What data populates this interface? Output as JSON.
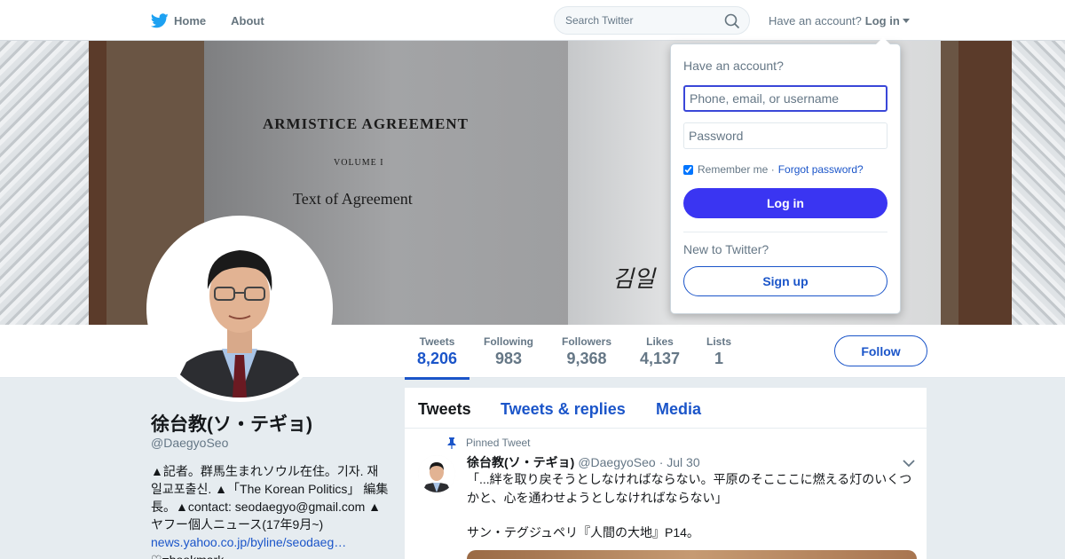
{
  "nav": {
    "home_label": "Home",
    "about_label": "About",
    "search_placeholder": "Search Twitter",
    "account_prompt": "Have an account?",
    "login_label": "Log in"
  },
  "banner": {
    "doc_title": "ARMISTICE AGREEMENT",
    "doc_volume": "VOLUME I",
    "doc_subtitle": "Text of Agreement"
  },
  "stats": [
    {
      "label": "Tweets",
      "value": "8,206"
    },
    {
      "label": "Following",
      "value": "983"
    },
    {
      "label": "Followers",
      "value": "9,368"
    },
    {
      "label": "Likes",
      "value": "4,137"
    },
    {
      "label": "Lists",
      "value": "1"
    }
  ],
  "follow_label": "Follow",
  "profile": {
    "name": "徐台教(ソ・テギョ)",
    "handle": "@DaegyoSeo",
    "bio_lines": [
      "▲記者。群馬生まれソウル在住。기자. 재일교포출신. ▲「The Korean Politics」 編集長。▲contact: seodaegyo@gmail.com ▲ヤフー個人ニュース(17年9月~)"
    ],
    "bio_link": "news.yahoo.co.jp/byline/seodaeg…",
    "bio_tail": "♡=bookmark"
  },
  "timeline": {
    "tabs": [
      "Tweets",
      "Tweets & replies",
      "Media"
    ],
    "pinned_label": "Pinned Tweet",
    "tweet_name": "徐台教(ソ・テギョ)",
    "tweet_handle": "@DaegyoSeo",
    "tweet_date": "· Jul 30",
    "tweet_text": "「...絆を取り戻そうとしなければならない。平原のそこここに燃える灯のいくつかと、心を通わせようとしなければならない」",
    "tweet_line2": "サン・テグジュペリ『人間の大地』P14。"
  },
  "login_dropdown": {
    "heading": "Have an account?",
    "username_placeholder": "Phone, email, or username",
    "password_placeholder": "Password",
    "remember_label": "Remember me ·",
    "forgot_label": "Forgot password?",
    "login_button": "Log in",
    "new_label": "New to Twitter?",
    "signup_button": "Sign up"
  },
  "colors": {
    "accent": "#1b55c9",
    "login_button": "#3a35f2",
    "twitter_blue": "#1da1f2"
  }
}
